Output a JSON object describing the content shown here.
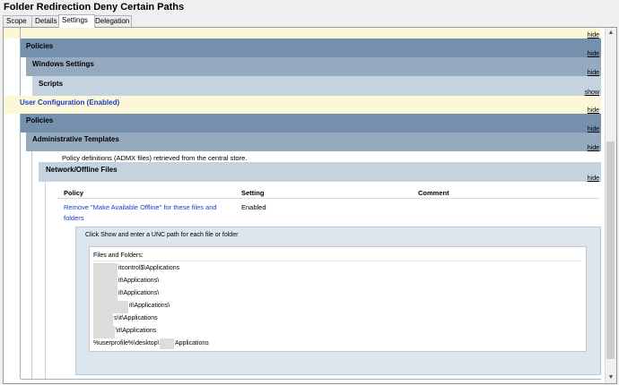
{
  "window": {
    "title": "Folder Redirection Deny Certain Paths"
  },
  "tabs": [
    {
      "label": "Scope"
    },
    {
      "label": "Details"
    },
    {
      "label": "Settings"
    },
    {
      "label": "Delegation"
    }
  ],
  "report": {
    "hide_label": "hide",
    "show_label": "show",
    "policies_label": "Policies",
    "windows_settings_label": "Windows Settings",
    "scripts_label": "Scripts",
    "user_configuration_label": "User Configuration (Enabled)",
    "admin_templates_label": "Administrative Templates",
    "admx_note": "Policy definitions (ADMX files) retrieved from the central store.",
    "network_offline_label": "Network/Offline Files",
    "table": {
      "headers": {
        "policy": "Policy",
        "setting": "Setting",
        "comment": "Comment"
      },
      "policy_line1": "Remove \"Make Available Offline\" for these files and",
      "policy_line2": "folders",
      "setting": "Enabled"
    },
    "panel": {
      "instruction": "Click Show and enter a UNC path for each file or folder",
      "files_header": "Files and Folders:",
      "entries": [
        "itcontrol$\\Applications",
        "it\\Applications\\",
        "it\\Applications\\",
        "it\\Applications\\",
        "s\\it\\Applications",
        "\\it\\Applications",
        "Applications"
      ],
      "last_prefix": "%userprofile%\\desktop\\"
    }
  }
}
